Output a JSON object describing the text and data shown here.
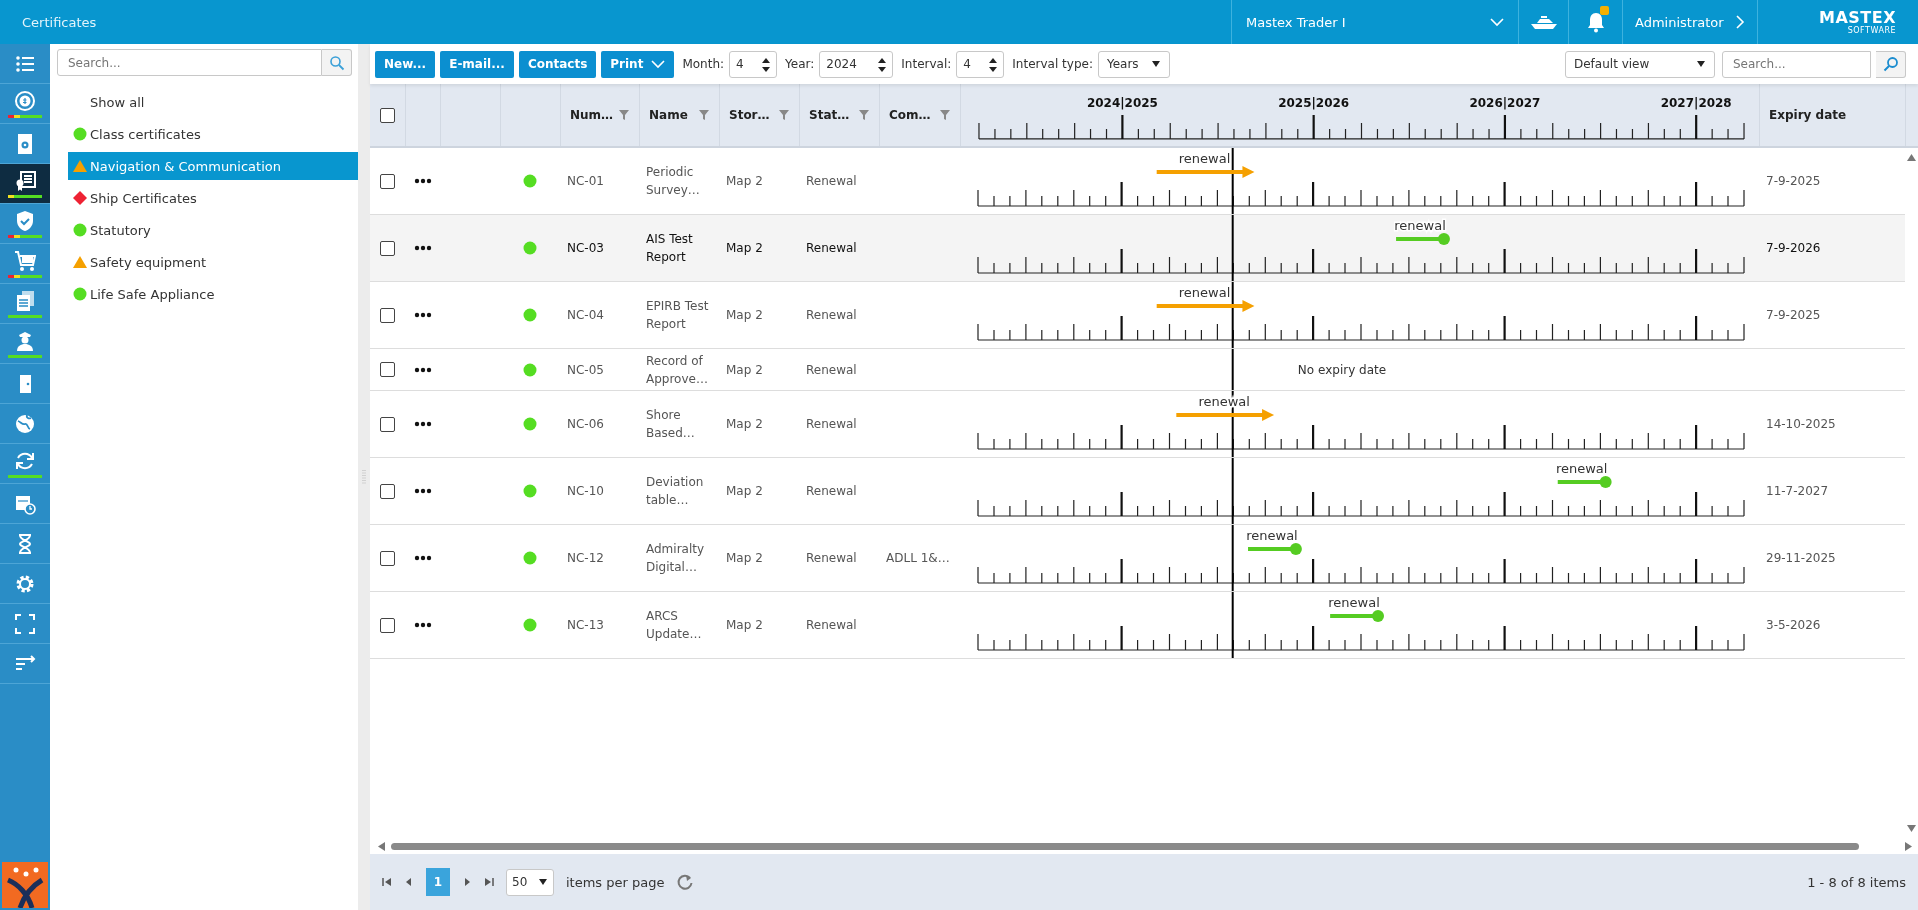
{
  "top_bar": {
    "title": "Certificates",
    "vessel": "Mastex Trader I",
    "notification": true,
    "user": "Administrator",
    "logo": {
      "name": "MASTEX",
      "tagline": "SOFTWARE"
    }
  },
  "nav_rail": {
    "items": [
      {
        "selected": false
      },
      {
        "selected": false,
        "strip": [
          {
            "color": "#ee2233"
          },
          {
            "color": "#f0e020"
          },
          {
            "color": "#55dd22"
          }
        ]
      },
      {
        "selected": false
      },
      {
        "selected": true,
        "strip": [
          {
            "color": "#f0e020"
          },
          {
            "color": "#55dd22"
          }
        ]
      },
      {
        "selected": false,
        "strip": [
          {
            "color": "#ee2233"
          },
          {
            "color": "#f0e020"
          },
          {
            "color": "#55dd22"
          }
        ]
      },
      {
        "selected": false,
        "strip": [
          {
            "color": "#ee2233"
          },
          {
            "color": "#f0e020"
          },
          {
            "color": "#55dd22"
          }
        ]
      },
      {
        "selected": false,
        "strip": [
          {
            "color": "#55dd22"
          }
        ]
      },
      {
        "selected": false,
        "strip": [
          {
            "color": "#55dd22"
          }
        ]
      },
      {
        "selected": false
      },
      {
        "selected": false
      },
      {
        "selected": false,
        "strip": [
          {
            "color": "#55dd22"
          }
        ]
      },
      {
        "selected": false
      },
      {
        "selected": false
      },
      {
        "selected": false
      },
      {
        "selected": false
      },
      {
        "selected": false
      }
    ]
  },
  "tree": {
    "search": {
      "placeholder": "Search..."
    },
    "items": [
      {
        "label": "Show all",
        "kind": "none",
        "selected": false
      },
      {
        "label": "Class certificates",
        "kind": "circle",
        "color": "#55dd22",
        "selected": false
      },
      {
        "label": "Navigation & Communication",
        "kind": "triangle",
        "color": "#f5a000",
        "selected": true
      },
      {
        "label": "Ship Certificates",
        "kind": "diamond",
        "color": "#ee2233",
        "selected": false
      },
      {
        "label": "Statutory",
        "kind": "circle",
        "color": "#55dd22",
        "selected": false
      },
      {
        "label": "Safety equipment",
        "kind": "triangle",
        "color": "#f5a000",
        "selected": false
      },
      {
        "label": "Life Safe Appliance",
        "kind": "circle",
        "color": "#55dd22",
        "selected": false
      }
    ]
  },
  "toolbar": {
    "buttons": [
      {
        "label": "New...",
        "kind": "plain"
      },
      {
        "label": "E-mail...",
        "kind": "plain"
      },
      {
        "label": "Contacts",
        "kind": "plain"
      },
      {
        "label": "Print",
        "kind": "dropdown"
      }
    ],
    "month": {
      "label": "Month:",
      "value": "4"
    },
    "year": {
      "label": "Year:",
      "value": "2024"
    },
    "interval": {
      "label": "Interval:",
      "value": "4"
    },
    "interval_type": {
      "label": "Interval type:",
      "value": "Years"
    },
    "view": {
      "value": "Default view"
    },
    "search": {
      "placeholder": "Search..."
    }
  },
  "grid": {
    "header_checked": false,
    "columns": [
      {
        "label": "Num…"
      },
      {
        "label": "Name"
      },
      {
        "label": "Stor…"
      },
      {
        "label": "Stat…"
      },
      {
        "label": "Com…"
      }
    ],
    "year_labels": [
      "2024|2025",
      "2025|2026",
      "2026|2027",
      "2027|2028"
    ],
    "expiry_header": "Expiry date",
    "rows": [
      {
        "checked": false,
        "hovered": false,
        "number": "NC-01",
        "name": "Periodic Survey…",
        "storage": "Map 2",
        "status": "Renewal",
        "timeline": {
          "kind": "arrow",
          "label": "renewal",
          "color": "#f5a000"
        },
        "expiry": "7-9-2025"
      },
      {
        "checked": false,
        "hovered": true,
        "number": "NC-03",
        "name": "AIS Test Report",
        "storage": "Map 2",
        "status": "Renewal",
        "timeline": {
          "kind": "dot",
          "label": "renewal",
          "color": "#55cc22"
        },
        "expiry": "7-9-2026"
      },
      {
        "checked": false,
        "hovered": false,
        "number": "NC-04",
        "name": "EPIRB Test Report",
        "storage": "Map 2",
        "status": "Renewal",
        "timeline": {
          "kind": "arrow",
          "label": "renewal",
          "color": "#f5a000"
        },
        "expiry": "7-9-2025"
      },
      {
        "checked": false,
        "hovered": false,
        "number": "NC-05",
        "name": "Record of Approve…",
        "storage": "Map 2",
        "status": "Renewal",
        "timeline": {
          "kind": "none",
          "note": "No expiry date"
        }
      },
      {
        "checked": false,
        "hovered": false,
        "number": "NC-06",
        "name": "Shore Based…",
        "storage": "Map 2",
        "status": "Renewal",
        "timeline": {
          "kind": "arrow",
          "label": "renewal",
          "color": "#f5a000"
        },
        "expiry": "14-10-2025"
      },
      {
        "checked": false,
        "hovered": false,
        "number": "NC-10",
        "name": "Deviation table…",
        "storage": "Map 2",
        "status": "Renewal",
        "timeline": {
          "kind": "dot",
          "label": "renewal",
          "color": "#55cc22"
        },
        "expiry": "11-7-2027"
      },
      {
        "checked": false,
        "hovered": false,
        "number": "NC-12",
        "name": "Admiralty Digital…",
        "storage": "Map 2",
        "status": "Renewal",
        "comment": "ADLL 1&…",
        "timeline": {
          "kind": "dot",
          "label": "renewal",
          "color": "#55cc22"
        },
        "expiry": "29-11-2025"
      },
      {
        "checked": false,
        "hovered": false,
        "number": "NC-13",
        "name": "ARCS Update…",
        "storage": "Map 2",
        "status": "Renewal",
        "timeline": {
          "kind": "dot",
          "label": "renewal",
          "color": "#55cc22"
        },
        "expiry": "3-5-2026"
      }
    ]
  },
  "pager": {
    "pages": [
      {
        "label": "1",
        "selected": true
      }
    ],
    "page_size": "50",
    "page_size_label": "items per page",
    "summary": "1 - 8 of 8 items"
  }
}
